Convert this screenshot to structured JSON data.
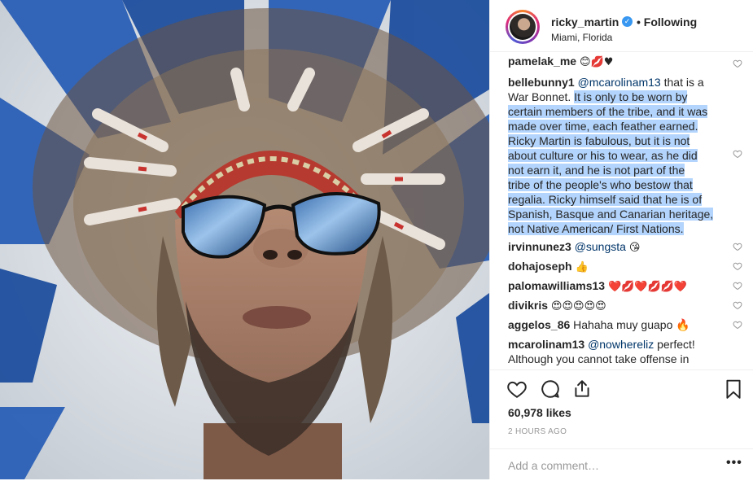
{
  "post": {
    "username": "ricky_martin",
    "follow_status": "Following",
    "location": "Miami, Florida",
    "likes": "60,978 likes",
    "time": "2 HOURS AGO",
    "add_comment_placeholder": "Add a comment…",
    "more_label": "•••"
  },
  "comments": [
    {
      "author": "pamelak_me",
      "text": "😊💋♥"
    },
    {
      "author": "bellebunny1",
      "mention": "@mcarolinam13",
      "text_pre": "that is a War Bonnet. ",
      "lines": [
        "It is only to be worn by",
        "certain members of the tribe, and it was",
        "made over time, each feather earned.",
        "Ricky Martin is fabulous, but it is not",
        "about culture or his to wear, as he did",
        "not earn it, and he is not part of the",
        "tribe of the people's who bestow that",
        "regalia. Ricky himself said that he is of",
        "Spanish, Basque and Canarian heritage,",
        "not Native American/ First Nations."
      ]
    },
    {
      "author": "irvinnunez3",
      "mention": "@sungsta",
      "text": "😘"
    },
    {
      "author": "dohajoseph",
      "text": "👍"
    },
    {
      "author": "palomawilliams13",
      "text": "❤️💋❤️💋💋❤️"
    },
    {
      "author": "divikris",
      "text": "😍😍😍😍😍"
    },
    {
      "author": "aggelos_86",
      "text": "Hahaha muy guapo 🔥"
    },
    {
      "author": "mcarolinam13",
      "mention": "@nowhereliz",
      "text": "perfect!",
      "text2": "Although you cannot take offense in"
    }
  ],
  "icons": {
    "verified": "verified-badge-icon",
    "like": "heart-icon",
    "comment": "comment-bubble-icon",
    "share": "share-icon",
    "save": "bookmark-icon",
    "comment_like": "small-heart-icon"
  },
  "colors": {
    "mention": "#003569",
    "highlight": "#b3d4fc",
    "verified": "#3897f0",
    "muted": "#999999"
  }
}
